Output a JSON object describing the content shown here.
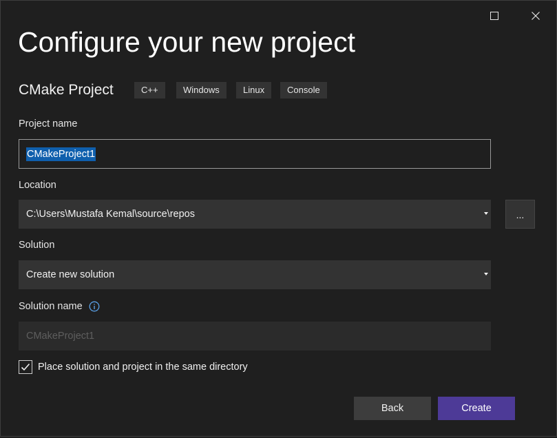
{
  "window": {
    "title": "Configure your new project",
    "maximize_icon": "maximize-icon",
    "close_icon": "close-icon"
  },
  "template": {
    "name": "CMake Project",
    "tags": [
      "C++",
      "Windows",
      "Linux",
      "Console"
    ]
  },
  "project_name": {
    "label": "Project name",
    "value": "CMakeProject1"
  },
  "location": {
    "label": "Location",
    "value": "C:\\Users\\Mustafa Kemal\\source\\repos",
    "browse_label": "..."
  },
  "solution": {
    "label": "Solution",
    "value": "Create new solution"
  },
  "solution_name": {
    "label": "Solution name",
    "info_icon": "info-icon",
    "placeholder": "CMakeProject1"
  },
  "same_directory": {
    "label": "Place solution and project in the same directory",
    "checked": true
  },
  "buttons": {
    "back": "Back",
    "create": "Create"
  },
  "colors": {
    "background": "#1f1f1f",
    "accent": "#4d3a97",
    "selection": "#0f5fad",
    "info": "#5aa0e6"
  }
}
